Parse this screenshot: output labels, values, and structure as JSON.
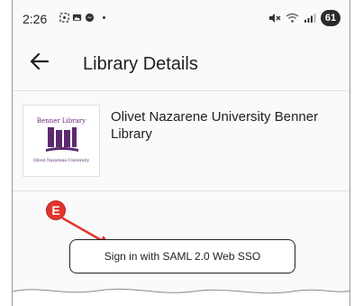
{
  "statusbar": {
    "time": "2:26",
    "battery": "61"
  },
  "appbar": {
    "title": "Library Details",
    "back_icon": "arrow-left-icon"
  },
  "library": {
    "name": "Olivet Nazarene University Benner Library",
    "logo": {
      "top_text": "Benner Library",
      "bottom_text": "Olivet Nazarene University"
    }
  },
  "annotation": {
    "badge": "E",
    "color": "#e2342d"
  },
  "actions": {
    "sso_label": "Sign in with SAML 2.0 Web SSO"
  },
  "colors": {
    "logo_purple": "#5b2a6e",
    "annotation_red": "#e2342d"
  }
}
